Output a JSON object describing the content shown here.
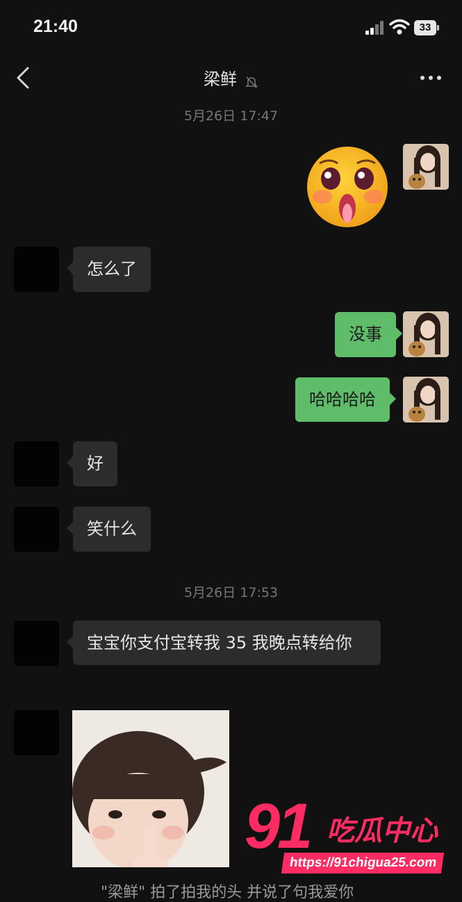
{
  "status_bar": {
    "time": "21:40",
    "battery": "33"
  },
  "header": {
    "title": "梁鲜"
  },
  "messages": [
    {
      "timestamp": "5月26日 17:47"
    },
    {
      "sender": "other",
      "text": "怎么了"
    },
    {
      "sender": "self",
      "text": "没事"
    },
    {
      "sender": "self",
      "text": "哈哈哈哈"
    },
    {
      "sender": "other",
      "text": "好"
    },
    {
      "sender": "other",
      "text": "笑什么"
    },
    {
      "timestamp": "5月26日 17:53"
    },
    {
      "sender": "other",
      "text": "宝宝你支付宝转我 35 我晚点转给你"
    }
  ],
  "bottom_partial_text": "\"梁鲜\" 拍了拍我的头 并说了句我爱你",
  "watermark": {
    "brand": "91",
    "brand_cn": "吃瓜中心",
    "url": "https://91chigua25.com"
  },
  "colors": {
    "background": "#111111",
    "self_bubble": "#5fbd6a",
    "other_bubble": "#2c2c2c",
    "watermark": "#ff2b63"
  },
  "icons": [
    "back-icon",
    "mute-bell-icon",
    "more-icon",
    "signal-icon",
    "wifi-icon",
    "battery-icon"
  ]
}
